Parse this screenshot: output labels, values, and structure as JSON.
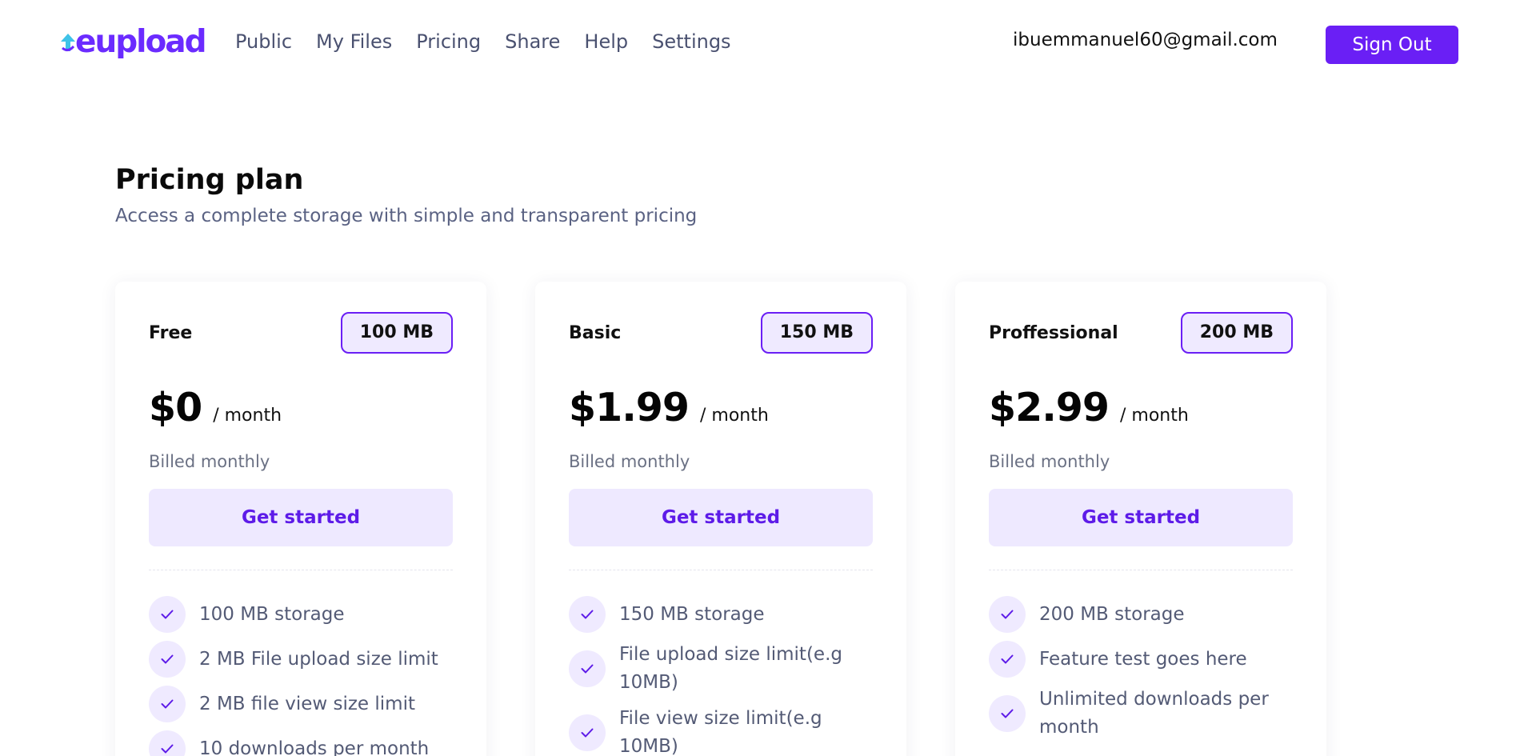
{
  "header": {
    "logo_text": "eupload",
    "nav": [
      "Public",
      "My Files",
      "Pricing",
      "Share",
      "Help",
      "Settings"
    ],
    "user_email": "ibuemmanuel60@gmail.com",
    "sign_out_label": "Sign Out"
  },
  "page": {
    "title": "Pricing plan",
    "subtitle": "Access a complete storage with simple and transparent pricing"
  },
  "colors": {
    "accent": "#6a1ff5",
    "accent_light": "#efeaff",
    "muted_text": "#5a6283"
  },
  "plans": [
    {
      "name": "Free",
      "size_badge": "100 MB",
      "price": "$0",
      "period": "/ month",
      "billing": "Billed monthly",
      "cta": "Get started",
      "features": [
        "100 MB storage",
        "2 MB File upload size limit",
        "2 MB file view size limit",
        "10 downloads per month"
      ]
    },
    {
      "name": "Basic",
      "size_badge": "150 MB",
      "price": "$1.99",
      "period": "/ month",
      "billing": "Billed monthly",
      "cta": "Get started",
      "features": [
        "150 MB storage",
        "File upload size limit(e.g 10MB)",
        "File view size limit(e.g 10MB)"
      ]
    },
    {
      "name": "Proffessional",
      "size_badge": "200 MB",
      "price": "$2.99",
      "period": "/ month",
      "billing": "Billed monthly",
      "cta": "Get started",
      "features": [
        "200 MB storage",
        "Feature test goes here",
        "Unlimited downloads per month"
      ]
    }
  ]
}
